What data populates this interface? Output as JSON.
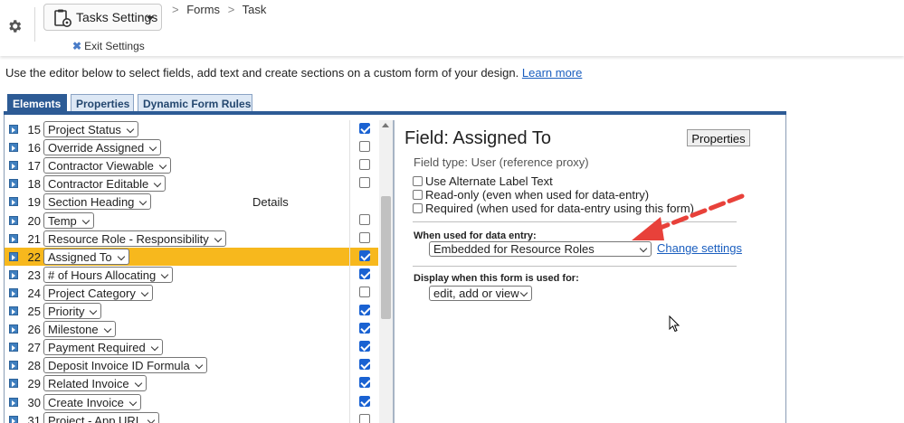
{
  "header": {
    "settings_button": "Tasks Settings",
    "breadcrumbs": [
      "Forms",
      "Task"
    ],
    "exit_label": "Exit Settings"
  },
  "instructions": {
    "text": "Use the editor below to select fields, add text and create sections on a custom form of your design.",
    "link": "Learn more"
  },
  "tabs": [
    "Elements",
    "Properties",
    "Dynamic Form Rules"
  ],
  "fields": [
    {
      "num": "15",
      "name": "Project Status",
      "checked": true
    },
    {
      "num": "16",
      "name": "Override Assigned",
      "checked": false
    },
    {
      "num": "17",
      "name": "Contractor Viewable",
      "checked": false
    },
    {
      "num": "18",
      "name": "Contractor Editable",
      "checked": false
    },
    {
      "num": "19",
      "name": "Section Heading",
      "extra": "Details"
    },
    {
      "num": "20",
      "name": "Temp",
      "checked": false
    },
    {
      "num": "21",
      "name": "Resource Role - Responsibility",
      "checked": false
    },
    {
      "num": "22",
      "name": "Assigned To",
      "checked": true,
      "selected": true
    },
    {
      "num": "23",
      "name": "# of Hours Allocating",
      "checked": true
    },
    {
      "num": "24",
      "name": "Project Category",
      "checked": false
    },
    {
      "num": "25",
      "name": "Priority",
      "checked": true
    },
    {
      "num": "26",
      "name": "Milestone",
      "checked": true
    },
    {
      "num": "27",
      "name": "Payment Required",
      "checked": true
    },
    {
      "num": "28",
      "name": "Deposit Invoice ID Formula",
      "checked": true
    },
    {
      "num": "29",
      "name": "Related Invoice",
      "checked": true
    },
    {
      "num": "30",
      "name": "Create Invoice",
      "checked": true
    },
    {
      "num": "31",
      "name": "Project - App URL",
      "checked": false
    }
  ],
  "detail": {
    "title": "Field: Assigned To",
    "properties_button": "Properties",
    "field_type": "Field type: User (reference proxy)",
    "options": [
      "Use Alternate Label Text",
      "Read-only (even when used for data-entry)",
      "Required (when used for data-entry using this form)"
    ],
    "data_entry_label": "When used for data entry:",
    "data_entry_value": "Embedded for Resource Roles",
    "change_settings": "Change settings",
    "display_label": "Display when this form is used for:",
    "display_value": "edit, add or view"
  },
  "colors": {
    "accent": "#2d5b95",
    "selected_row": "#f7b81d",
    "link": "#1a5ebf",
    "arrow": "#e8413a"
  },
  "icons": {
    "settings": "gear-icon",
    "tasks": "clipboard-gear-icon",
    "exit": "close-icon"
  }
}
